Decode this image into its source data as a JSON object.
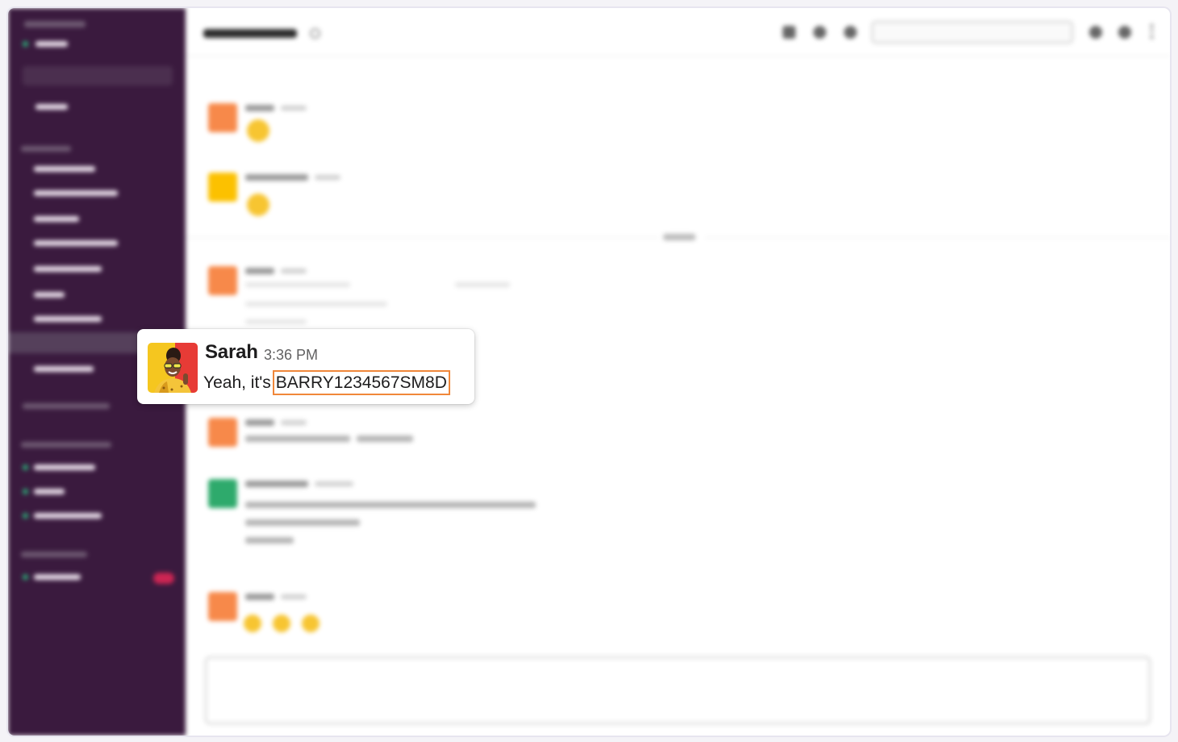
{
  "message": {
    "sender": "Sarah",
    "time": "3:36 PM",
    "text_prefix": "Yeah, it's",
    "highlighted_code": "BARRY1234567SM8D"
  },
  "colors": {
    "sidebar": "#3a1a3e",
    "highlight_border": "#f0873a",
    "presence": "#2bac76"
  },
  "icons": [
    "phone-icon",
    "info-icon",
    "settings-icon",
    "search-icon",
    "at-icon",
    "star-icon",
    "more-icon"
  ]
}
